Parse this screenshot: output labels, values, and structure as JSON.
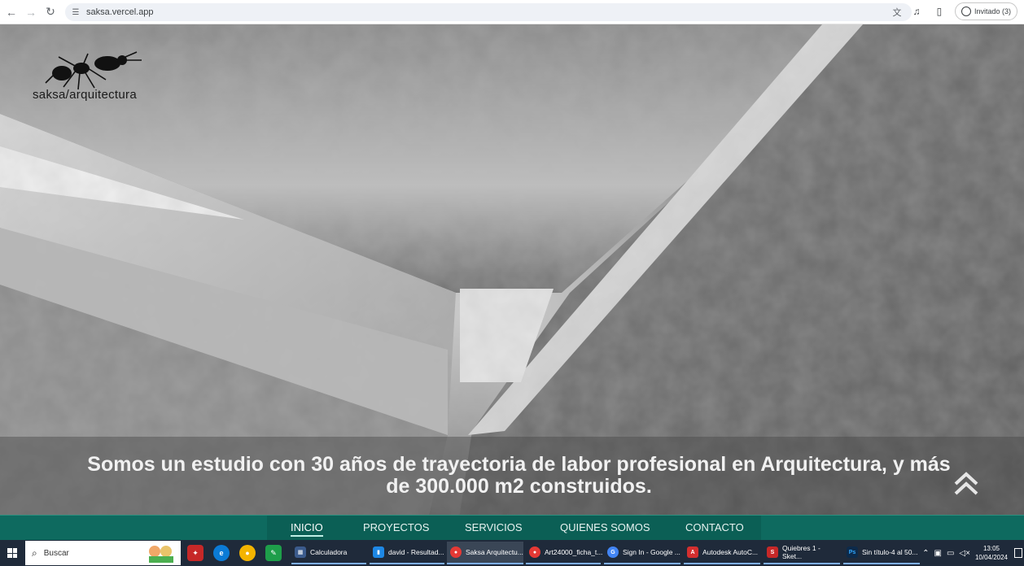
{
  "browser": {
    "url": "saksa.vercel.app",
    "profile_label": "Invitado (3)",
    "icons": [
      "back-icon",
      "forward-icon",
      "reload-icon",
      "site-info-icon",
      "translate-icon",
      "media-controls-icon",
      "side-panel-icon",
      "profile-icon"
    ]
  },
  "site": {
    "logo_text": "saksa/arquitectura",
    "tagline": "Somos un estudio con 30 años de trayectoria de labor profesional en Arquitectura, y más de 300.000 m2 construidos.",
    "nav": [
      {
        "label": "INICIO",
        "active": true
      },
      {
        "label": "PROYECTOS",
        "active": false
      },
      {
        "label": "SERVICIOS",
        "active": false
      },
      {
        "label": "QUIENES SOMOS",
        "active": false
      },
      {
        "label": "CONTACTO",
        "active": false
      }
    ],
    "colors": {
      "nav_bg": "#0e6a5f",
      "nav_inner": "#0b5f55",
      "tagline": "#f1f1f1"
    }
  },
  "taskbar": {
    "search_placeholder": "Buscar",
    "apps": [
      {
        "label": "Calculadora",
        "icon": "calculator-icon",
        "color": "#3b5b8c"
      },
      {
        "label": "david - Resultad...",
        "icon": "file-explorer-icon",
        "color": "#1e88e5"
      },
      {
        "label": "Saksa Arquitectu...",
        "icon": "chrome-icon",
        "color": "#e53935",
        "active": true
      },
      {
        "label": "Art24000_ficha_t...",
        "icon": "chrome-icon",
        "color": "#e53935"
      },
      {
        "label": "Sign In - Google ...",
        "icon": "google-icon",
        "color": "#4285f4"
      },
      {
        "label": "Autodesk AutoC...",
        "icon": "autocad-icon",
        "color": "#d32f2f"
      },
      {
        "label": "Quiebres 1 - Sket...",
        "icon": "sketchup-icon",
        "color": "#c62828"
      },
      {
        "label": "Sin título-4 al 50...",
        "icon": "photoshop-icon",
        "color": "#0d2a4a"
      }
    ],
    "time": "13:05",
    "date": "10/04/2024"
  }
}
